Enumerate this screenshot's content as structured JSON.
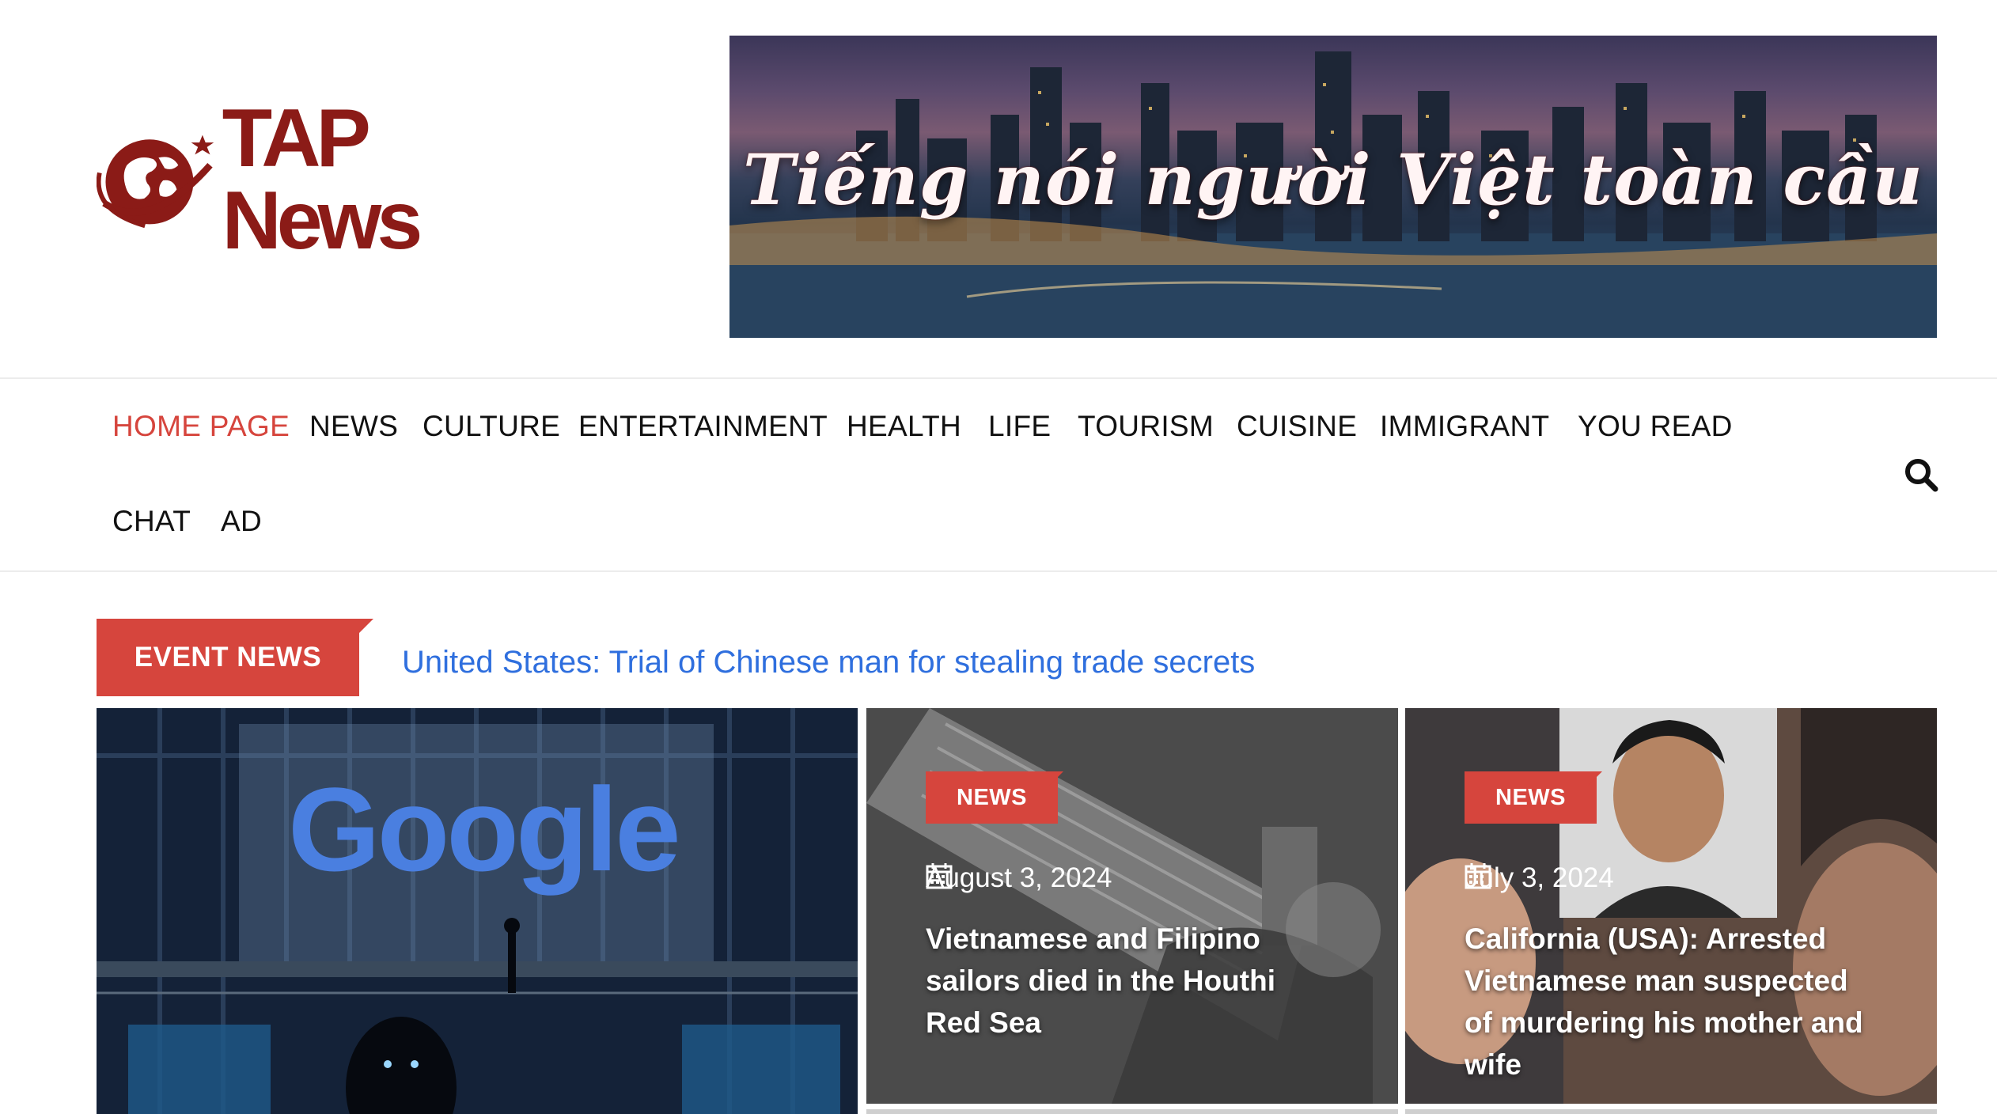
{
  "header": {
    "logo_text": "TAP News",
    "banner_slogan": "Tiếng nói người Việt toàn cầu"
  },
  "nav": {
    "items": [
      {
        "label": "HOME PAGE",
        "active": true
      },
      {
        "label": "NEWS",
        "active": false
      },
      {
        "label": "CULTURE",
        "active": false
      },
      {
        "label": "ENTERTAINMENT",
        "active": false
      },
      {
        "label": "HEALTH",
        "active": false
      },
      {
        "label": "LIFE",
        "active": false
      },
      {
        "label": "TOURISM",
        "active": false
      },
      {
        "label": "CUISINE",
        "active": false
      },
      {
        "label": "IMMIGRANT",
        "active": false
      },
      {
        "label": "YOU READ",
        "active": false
      },
      {
        "label": "CHAT",
        "active": false
      },
      {
        "label": "AD",
        "active": false
      }
    ],
    "search_icon": "search-icon"
  },
  "ticker": {
    "label": "EVENT NEWS",
    "headline": "United States: Trial of Chinese man for stealing trade secrets"
  },
  "cards": [
    {
      "category": "NEWS",
      "date": "August 3, 2024",
      "title": "Vietnamese and Filipino sailors died in the Houthi Red Sea"
    },
    {
      "category": "NEWS",
      "date": "July 3, 2024",
      "title": "California (USA): Arrested Vietnamese man suspected of murdering his mother and wife"
    }
  ],
  "featured_image": {
    "sign_text": "Google"
  },
  "colors": {
    "accent": "#d6453d",
    "brand": "#8b1b17",
    "link": "#2f6fde",
    "text": "#111111"
  }
}
